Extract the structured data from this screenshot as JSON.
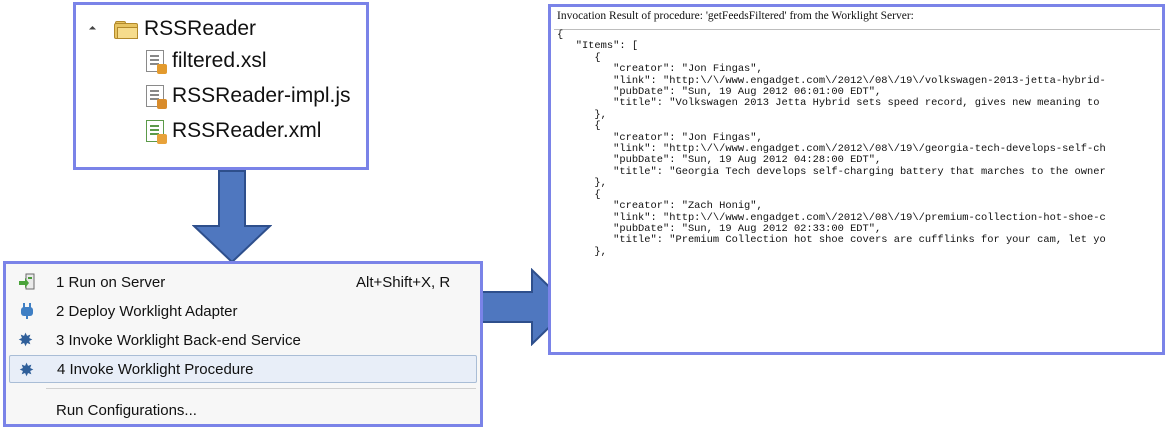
{
  "tree": {
    "project": "RSSReader",
    "files": [
      {
        "name": "filtered.xsl",
        "icon": "xsl-file-icon"
      },
      {
        "name": "RSSReader-impl.js",
        "icon": "js-file-icon"
      },
      {
        "name": "RSSReader.xml",
        "icon": "xml-file-icon"
      }
    ]
  },
  "menu": {
    "items": [
      {
        "label": "1 Run on Server",
        "accel": "Alt+Shift+X, R",
        "icon": "run-on-server-icon"
      },
      {
        "label": "2 Deploy Worklight Adapter",
        "icon": "deploy-adapter-icon"
      },
      {
        "label": "3 Invoke Worklight Back-end Service",
        "icon": "gear-icon"
      },
      {
        "label": "4 Invoke Worklight Procedure",
        "icon": "gear-icon"
      },
      {
        "label": "Run Configurations..."
      }
    ]
  },
  "result": {
    "title": "Invocation Result of procedure: 'getFeedsFiltered' from the Worklight Server:",
    "lines": [
      "{",
      "   \"Items\": [",
      "      {",
      "         \"creator\": \"Jon Fingas\",",
      "         \"link\": \"http:\\/\\/www.engadget.com\\/2012\\/08\\/19\\/volkswagen-2013-jetta-hybrid-",
      "         \"pubDate\": \"Sun, 19 Aug 2012 06:01:00 EDT\",",
      "         \"title\": \"Volkswagen 2013 Jetta Hybrid sets speed record, gives new meaning to",
      "      },",
      "      {",
      "         \"creator\": \"Jon Fingas\",",
      "         \"link\": \"http:\\/\\/www.engadget.com\\/2012\\/08\\/19\\/georgia-tech-develops-self-ch",
      "         \"pubDate\": \"Sun, 19 Aug 2012 04:28:00 EDT\",",
      "         \"title\": \"Georgia Tech develops self-charging battery that marches to the owner",
      "      },",
      "      {",
      "         \"creator\": \"Zach Honig\",",
      "         \"link\": \"http:\\/\\/www.engadget.com\\/2012\\/08\\/19\\/premium-collection-hot-shoe-c",
      "         \"pubDate\": \"Sun, 19 Aug 2012 02:33:00 EDT\",",
      "         \"title\": \"Premium Collection hot shoe covers are cufflinks for your cam, let yo",
      "      },"
    ]
  },
  "colors": {
    "panel_border": "#7a83e8",
    "arrow_fill": "#4f77bf",
    "arrow_stroke": "#2e4f8c"
  }
}
